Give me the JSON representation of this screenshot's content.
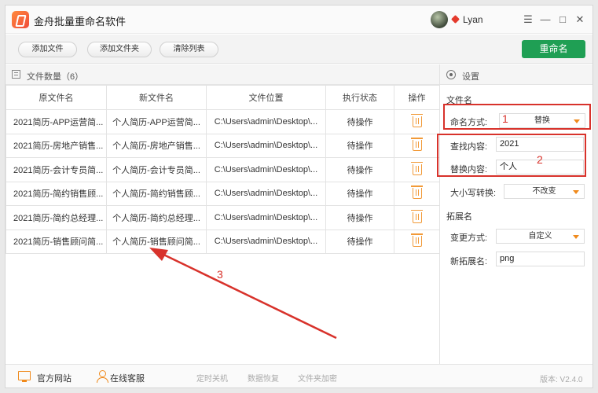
{
  "app": {
    "title": "金舟批量重命名软件",
    "username": "Lyan"
  },
  "window_controls": {
    "menu": "☰",
    "minimize": "—",
    "maximize": "□",
    "close": "✕"
  },
  "toolbar": {
    "add_file": "添加文件",
    "add_folder": "添加文件夹",
    "clear_list": "清除列表",
    "rename": "重命名"
  },
  "list": {
    "title": "文件数量（6）",
    "columns": [
      "原文件名",
      "新文件名",
      "文件位置",
      "执行状态",
      "操作"
    ],
    "rows": [
      [
        "2021简历-APP运营简...",
        "个人简历-APP运营简...",
        "C:\\Users\\admin\\Desktop\\...",
        "待操作"
      ],
      [
        "2021简历-房地产销售...",
        "个人简历-房地产销售...",
        "C:\\Users\\admin\\Desktop\\...",
        "待操作"
      ],
      [
        "2021简历-会计专员简...",
        "个人简历-会计专员简...",
        "C:\\Users\\admin\\Desktop\\...",
        "待操作"
      ],
      [
        "2021简历-简约销售顾...",
        "个人简历-简约销售顾...",
        "C:\\Users\\admin\\Desktop\\...",
        "待操作"
      ],
      [
        "2021简历-简约总经理...",
        "个人简历-简约总经理...",
        "C:\\Users\\admin\\Desktop\\...",
        "待操作"
      ],
      [
        "2021简历-销售顾问简...",
        "个人简历-销售顾问简...",
        "C:\\Users\\admin\\Desktop\\...",
        "待操作"
      ]
    ]
  },
  "settings": {
    "title": "设置",
    "filename_section": "文件名",
    "naming_method_label": "命名方式:",
    "naming_method_value": "替换",
    "find_label": "查找内容:",
    "find_value": "2021",
    "replace_label": "替换内容:",
    "replace_value": "个人",
    "case_label": "大小写转换:",
    "case_value": "不改变",
    "ext_section": "拓展名",
    "change_method_label": "变更方式:",
    "change_method_value": "自定义",
    "new_ext_label": "新拓展名:",
    "new_ext_value": "png"
  },
  "annotations": {
    "n1": "1",
    "n2": "2",
    "n3": "3",
    "color": "#d8322b"
  },
  "footer": {
    "website": "官方网站",
    "support": "在线客服",
    "shutdown": "定时关机",
    "recovery": "数据恢复",
    "encrypt": "文件夹加密",
    "version": "版本: V2.4.0"
  }
}
